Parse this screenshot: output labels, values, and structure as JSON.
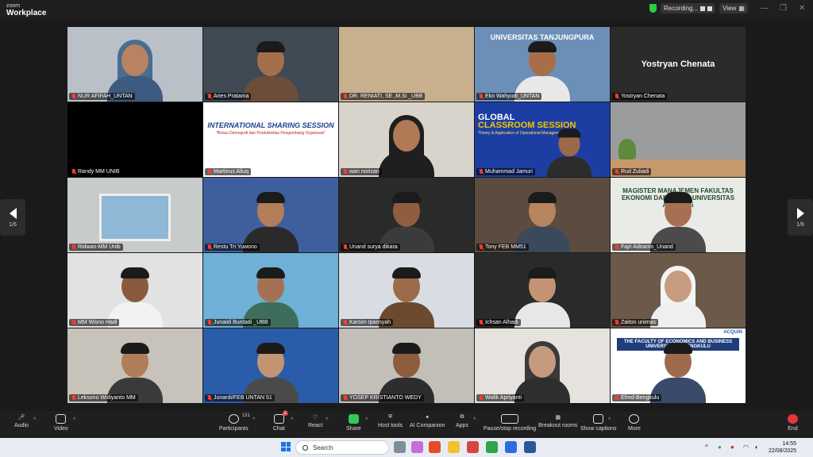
{
  "app": {
    "brand_small": "zoom",
    "brand_name": "Workplace"
  },
  "recording": {
    "label": "Recording...",
    "view_label": "View"
  },
  "pager": {
    "left": "1/6",
    "right": "1/6"
  },
  "tiles": [
    {
      "name": "NUR AFIFAH_UNTAN",
      "kind": "video",
      "bg": "#b9c0c7",
      "skin": "#b98361",
      "shirt": "#3d5a80",
      "hijab": "#4a6c8f"
    },
    {
      "name": "Aries Pratama",
      "kind": "video",
      "bg": "#3f4a54",
      "skin": "#a46f4c",
      "shirt": "#6b4e3a",
      "active": true
    },
    {
      "name": "DR. RENIATI, SE.,M.Si _UBB",
      "kind": "blank",
      "bg": "#c8b08e"
    },
    {
      "name": "Eko Wahyudi_UNTAN",
      "kind": "slide_univ",
      "bg": "#6c8fb8",
      "skin": "#a86e48",
      "shirt": "#e8e8e8",
      "banner": "UNIVERSITAS TANJUNGPURA"
    },
    {
      "name": "Yostryan Chenata",
      "kind": "name_only",
      "bg": "#2b2b2b",
      "display": "Yostryan Chenata"
    },
    {
      "name": "Randy MM UNIB",
      "kind": "blank",
      "bg": "#000000"
    },
    {
      "name": "Martinus Aliuq",
      "kind": "poster",
      "bg": "#ffffff",
      "title": "INTERNATIONAL SHARING SESSION",
      "subtitle": "\"Bonus Demografi dan Produktivitas Pengembang Organisasi\""
    },
    {
      "name": "wan norizan",
      "kind": "video",
      "bg": "#d8d4cc",
      "skin": "#b07a57",
      "shirt": "#1f1f1f",
      "hijab": "#1f1f1f"
    },
    {
      "name": "Muhammad Jamuri",
      "kind": "slide_global",
      "bg": "#1c3ea3",
      "skin": "#9c6a4a",
      "shirt": "#2d2d2d",
      "title_a": "GLOBAL",
      "title_b": "CLASSROOM SESSION",
      "subtitle": "Theory & Application of Operational Management"
    },
    {
      "name": "Rud Zuliadi",
      "kind": "room",
      "bg": "#9b9c9e"
    },
    {
      "name": "Ridwan-MM Unib",
      "kind": "window",
      "bg": "#c7cbc9"
    },
    {
      "name": "Restu Tri Yuwono",
      "kind": "video",
      "bg": "#3e5f9e",
      "skin": "#b27e5a",
      "shirt": "#2a2a2a"
    },
    {
      "name": "Unand surya dikara",
      "kind": "video",
      "bg": "#2a2a2a",
      "skin": "#8f5e3e",
      "shirt": "#3b3b3b"
    },
    {
      "name": "Tony FEB MM51",
      "kind": "video",
      "bg": "#5c4b3f",
      "skin": "#b6845f",
      "shirt": "#3a4a5c"
    },
    {
      "name": "Fajri Adrianto_Unand",
      "kind": "magister",
      "bg": "#e9ebe6",
      "skin": "#a87052",
      "shirt": "#4b4b4b",
      "banner": "MAGISTER MANAJEMEN FAKULTAS EKONOMI DAN BISNIS UNIVERSITAS ANDALAS"
    },
    {
      "name": "MM Wisno Hadi",
      "kind": "video",
      "bg": "#e2e2e2",
      "skin": "#8a5a3c",
      "shirt": "#f2f2f2"
    },
    {
      "name": "Junaidi Burdadi _UBB",
      "kind": "video",
      "bg": "#6fb0d6",
      "skin": "#a47252",
      "shirt": "#3d6e5b"
    },
    {
      "name": "Karsim Ipansyah",
      "kind": "video",
      "bg": "#d9dde3",
      "skin": "#9c6b4a",
      "shirt": "#6b4a2f"
    },
    {
      "name": "Ichsan Alhadi",
      "kind": "video",
      "bg": "#2a2a2a",
      "skin": "#c49373",
      "shirt": "#e7e7e7"
    },
    {
      "name": "Zaiton unimas",
      "kind": "video",
      "bg": "#6b5a4a",
      "skin": "#c89c80",
      "shirt": "#efefef",
      "hijab": "#f4f4f4"
    },
    {
      "name": "Leksono Widiyanto MM",
      "kind": "video",
      "bg": "#c7c2ba",
      "skin": "#b07d5a",
      "shirt": "#3a3a3a"
    },
    {
      "name": "Junardi/FEB UNTAN 51",
      "kind": "video",
      "bg": "#2b5caa",
      "skin": "#c29570",
      "shirt": "#4a4a4a"
    },
    {
      "name": "YOSEP KRISTIANTO WEDY",
      "kind": "video",
      "bg": "#c2bfb9",
      "skin": "#8d5d3e",
      "shirt": "#2d2d2d"
    },
    {
      "name": "Wafik Apriyanti",
      "kind": "video",
      "bg": "#e6e3de",
      "skin": "#c69a7c",
      "shirt": "#2e2e2e",
      "hijab": "#3a3a3a"
    },
    {
      "name": "Efred-Bengkulu",
      "kind": "slide_unib",
      "bg": "#ffffff",
      "skin": "#9d6b4c",
      "shirt": "#3a4a6a",
      "acquin": "ACQUIN",
      "banner": "THE FACULTY OF ECONOMICS AND BUSINESS UNIVERSITY OF BENGKULU"
    }
  ],
  "toolbar": {
    "audio": "Audio",
    "video": "Video",
    "participants": "Participants",
    "participants_count": "131",
    "chat": "Chat",
    "chat_badge": "2",
    "react": "React",
    "share": "Share",
    "host_tools": "Host tools",
    "ai_companion": "AI Companion",
    "apps": "Apps",
    "pause_recording": "Pause/stop recording",
    "breakout": "Breakout rooms",
    "captions": "Show captions",
    "more": "More",
    "end": "End"
  },
  "taskbar": {
    "search_placeholder": "Search",
    "time": "14:55",
    "date": "22/08/2025"
  }
}
